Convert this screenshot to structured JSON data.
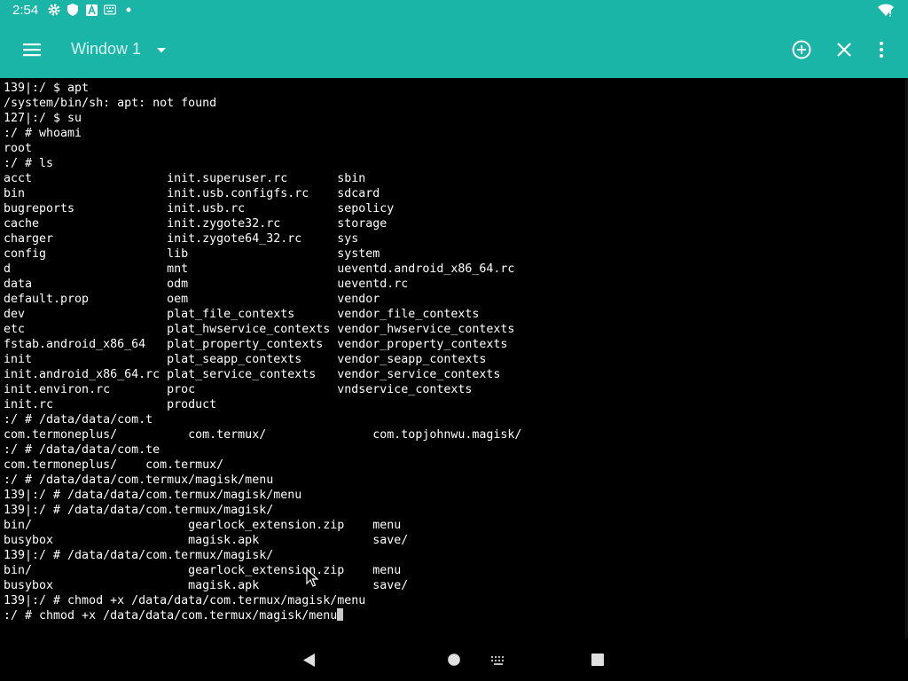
{
  "status": {
    "time": "2:54",
    "icons": [
      "gear-icon",
      "shield-icon",
      "font-icon",
      "keyboard-icon",
      "dot-icon",
      "wifi-icon"
    ]
  },
  "appbar": {
    "window_title": "Window 1",
    "colors": {
      "accent": "#1ab5a6",
      "title": "#d9f4f1"
    },
    "actions": [
      "menu-icon",
      "chevron-down-icon",
      "add-window-icon",
      "close-icon",
      "more-vert-icon"
    ]
  },
  "terminal": {
    "lines": [
      "139|:/ $ apt",
      "/system/bin/sh: apt: not found",
      "127|:/ $ su",
      ":/ # whoami",
      "root",
      ":/ # ls",
      "acct                   init.superuser.rc       sbin",
      "bin                    init.usb.configfs.rc    sdcard",
      "bugreports             init.usb.rc             sepolicy",
      "cache                  init.zygote32.rc        storage",
      "charger                init.zygote64_32.rc     sys",
      "config                 lib                     system",
      "d                      mnt                     ueventd.android_x86_64.rc",
      "data                   odm                     ueventd.rc",
      "default.prop           oem                     vendor",
      "dev                    plat_file_contexts      vendor_file_contexts",
      "etc                    plat_hwservice_contexts vendor_hwservice_contexts",
      "fstab.android_x86_64   plat_property_contexts  vendor_property_contexts",
      "init                   plat_seapp_contexts     vendor_seapp_contexts",
      "init.android_x86_64.rc plat_service_contexts   vendor_service_contexts",
      "init.environ.rc        proc                    vndservice_contexts",
      "init.rc                product",
      ":/ # /data/data/com.t",
      "com.termoneplus/          com.termux/               com.topjohnwu.magisk/",
      ":/ # /data/data/com.te",
      "com.termoneplus/    com.termux/",
      ":/ # /data/data/com.termux/magisk/menu",
      "139|:/ # /data/data/com.termux/magisk/menu",
      "139|:/ # /data/data/com.termux/magisk/",
      "bin/                      gearlock_extension.zip    menu",
      "busybox                   magisk.apk                save/",
      "139|:/ # /data/data/com.termux/magisk/",
      "bin/                      gearlock_extension.zip    menu",
      "busybox                   magisk.apk                save/",
      "139|:/ # chmod +x /data/data/com.termux/magisk/menu",
      ":/ # chmod +x /data/data/com.termux/magisk/menu"
    ]
  },
  "navbar": {
    "buttons": [
      "back-icon",
      "home-icon",
      "keyboard-icon",
      "recents-icon"
    ]
  }
}
